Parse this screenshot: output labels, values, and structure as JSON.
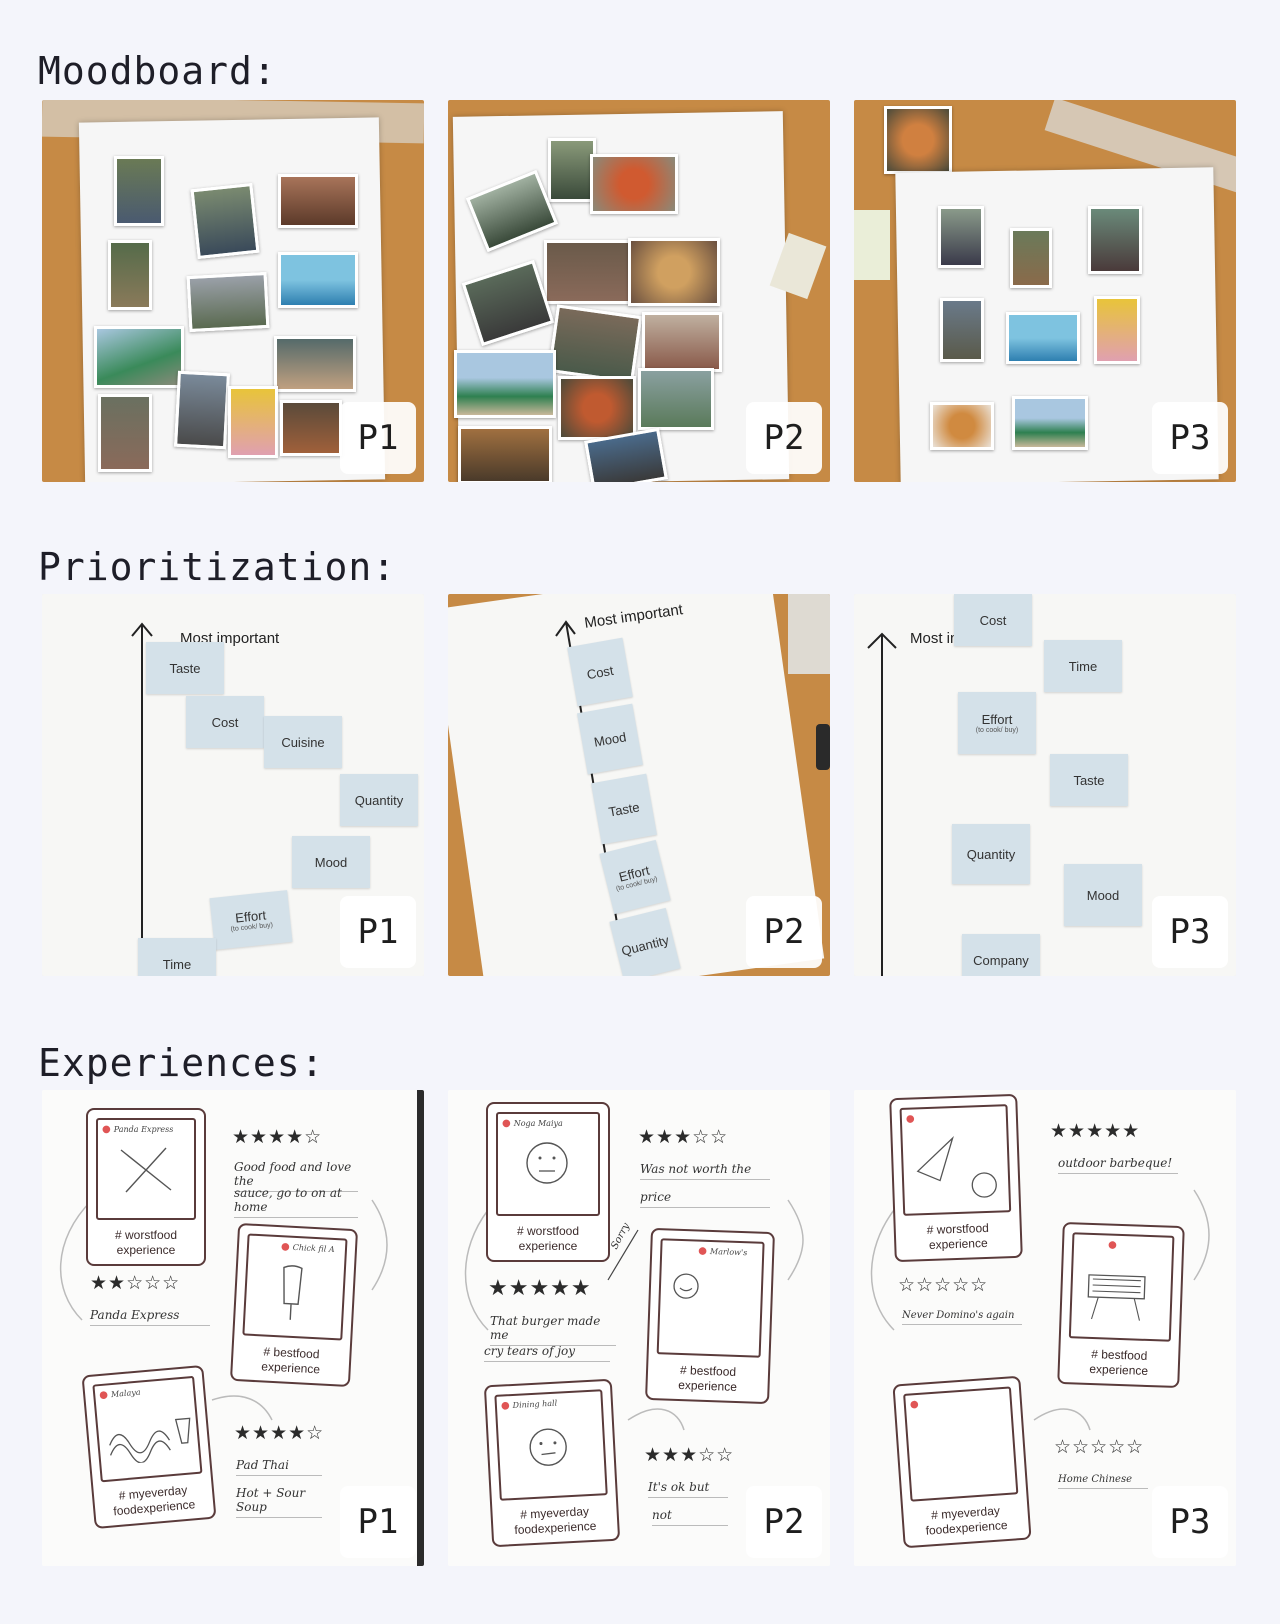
{
  "sections": {
    "moodboard": {
      "title": "Moodboard:"
    },
    "prioritization": {
      "title": "Prioritization:",
      "panels": [
        {
          "axis_label": "Most important",
          "cards": [
            "Taste",
            "Cost",
            "Cuisine",
            "Quantity",
            "Mood",
            "Effort",
            "Time"
          ],
          "effort_sub": "(to cook/ buy)"
        },
        {
          "axis_label": "Most important",
          "cards": [
            "Cost",
            "Mood",
            "Taste",
            "Effort",
            "Quantity"
          ],
          "effort_sub": "(to cook/ buy)"
        },
        {
          "axis_label": "Most important",
          "cards": [
            "Cost",
            "Time",
            "Effort",
            "Taste",
            "Quantity",
            "Mood",
            "Company"
          ],
          "effort_sub": "(to cook/ buy)"
        }
      ]
    },
    "experiences": {
      "title": "Experiences:",
      "tags": {
        "worst": "# worstfood\nexperience",
        "best": "# bestfood\nexperience",
        "everyday": "# myeverday\nfoodexperience"
      },
      "panels": [
        {
          "worst_loc": "Panda Express",
          "best_loc": "Chick fil A",
          "everyday_loc": "Malaya",
          "worst_stars": "★★☆☆☆",
          "best_stars": "★★★★☆",
          "everyday_stars": "★★★★☆",
          "worst_note": "Panda Express",
          "best_note_1": "Good food and love the",
          "best_note_2": "sauce, go to on at home",
          "everyday_note_1": "Pad Thai",
          "everyday_note_2": "Hot + Sour Soup"
        },
        {
          "worst_loc": "Noga Maiya",
          "best_loc": "Marlow's",
          "everyday_loc": "Dining hall",
          "worst_stars": "★★★☆☆",
          "best_stars": "★★★★★",
          "everyday_stars": "★★★☆☆",
          "worst_note": "Was not worth the",
          "worst_note_2": "price",
          "best_note_1": "That burger made me",
          "best_note_2": "cry tears of joy",
          "sorry": "Sorry",
          "everyday_note_1": "It's ok but",
          "everyday_note_2": "not"
        },
        {
          "worst_loc": "",
          "best_loc": "",
          "everyday_loc": "",
          "worst_stars": "☆☆☆☆☆",
          "best_stars": "★★★★★",
          "everyday_stars": "☆☆☆☆☆",
          "worst_note": "Never Domino's again",
          "best_note_1": "outdoor barbeque!",
          "everyday_note_1": "Home Chinese"
        }
      ]
    }
  },
  "badges": [
    "P1",
    "P2",
    "P3"
  ],
  "colors": {
    "background": "#f4f5fb",
    "wood": "#c68a45",
    "card": "#d4e1e9",
    "ink": "#5a3b3b",
    "pin": "#e05555"
  }
}
